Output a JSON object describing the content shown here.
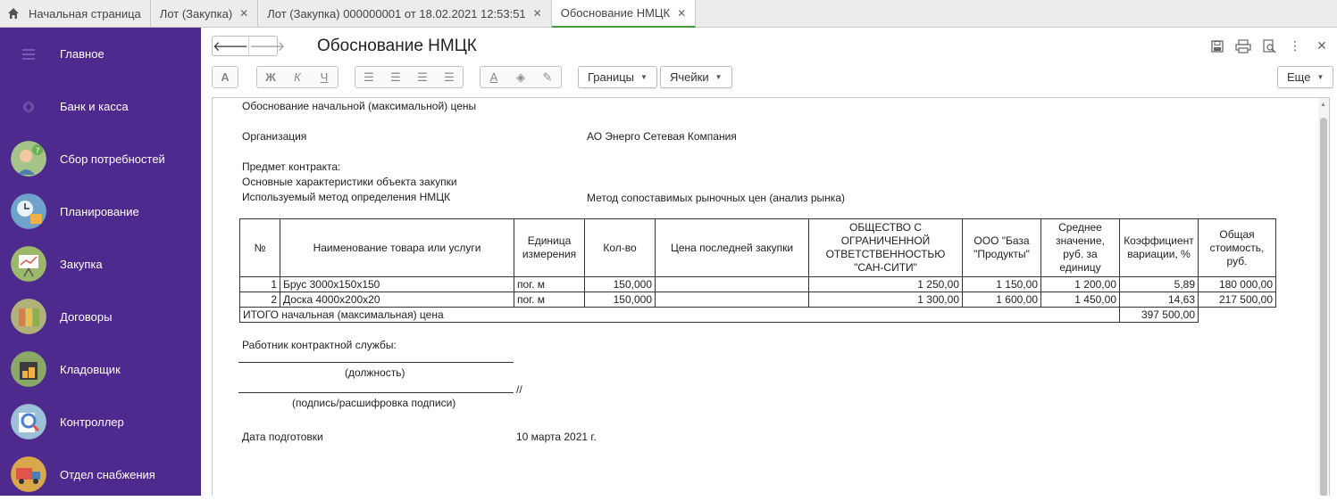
{
  "tabs": [
    {
      "label": "Начальная страница",
      "closable": false,
      "active": false
    },
    {
      "label": "Лот (Закупка)",
      "closable": true,
      "active": false
    },
    {
      "label": "Лот (Закупка) 000000001 от 18.02.2021 12:53:51",
      "closable": true,
      "active": false
    },
    {
      "label": "Обоснование НМЦК",
      "closable": true,
      "active": true
    }
  ],
  "sidebar": {
    "items": [
      {
        "label": "Главное",
        "icon": "menu-lines-icon"
      },
      {
        "label": "Банк и касса",
        "icon": "coin-icon"
      },
      {
        "label": "Сбор потребностей",
        "icon": "person-question-icon"
      },
      {
        "label": "Планирование",
        "icon": "calendar-clock-icon"
      },
      {
        "label": "Закупка",
        "icon": "chart-board-icon"
      },
      {
        "label": "Договоры",
        "icon": "folders-icon"
      },
      {
        "label": "Кладовщик",
        "icon": "warehouse-icon"
      },
      {
        "label": "Контроллер",
        "icon": "magnifier-icon"
      },
      {
        "label": "Отдел снабжения",
        "icon": "truck-icon"
      }
    ]
  },
  "form": {
    "title": "Обоснование НМЦК"
  },
  "toolbar": {
    "font_btn": "A",
    "bold": "Ж",
    "italic": "К",
    "underline": "Ч",
    "borders_label": "Границы",
    "cells_label": "Ячейки",
    "more_label": "Еще"
  },
  "doc": {
    "heading": "Обоснование начальной (максимальной) цены",
    "org_label": "Организация",
    "org_value": "АО Энерго Сетевая Компания",
    "subject_label": "Предмет контракта:",
    "characteristics_label": "Основные характеристики объекта закупки",
    "method_label": "Используемый метод определения НМЦК",
    "method_value": "Метод сопоставимых рыночных цен (анализ рынка)",
    "table": {
      "headers": [
        "№",
        "Наименование товара или услуги",
        "Единица измерения",
        "Кол-во",
        "Цена последней закупки",
        "ОБЩЕСТВО С ОГРАНИЧЕННОЙ ОТВЕТСТВЕННОСТЬЮ \"САН-СИТИ\"",
        "ООО \"База \"Продукты\"",
        "Среднее значение, руб. за единицу",
        "Коэффициент вариации, %",
        "Общая стоимость, руб."
      ],
      "rows": [
        [
          "1",
          "Брус 3000х150х150",
          "пог. м",
          "150,000",
          "",
          "1 250,00",
          "1 150,00",
          "1 200,00",
          "5,89",
          "180 000,00"
        ],
        [
          "2",
          "Доска 4000х200х20",
          "пог. м",
          "150,000",
          "",
          "1 300,00",
          "1 600,00",
          "1 450,00",
          "14,63",
          "217 500,00"
        ]
      ],
      "total_label": "ИТОГО начальная (максимальная) цена",
      "total_value": "397 500,00"
    },
    "worker_label": "Работник контрактной службы:",
    "position_caption": "(должность)",
    "signature_mark": "//",
    "signature_caption": "(подпись/расшифровка подписи)",
    "date_label": "Дата подготовки",
    "date_value": "10 марта 2021 г."
  },
  "colors": {
    "sidebar_bg": "#4e2a8e",
    "active_tab_underline": "#3ca13c"
  }
}
